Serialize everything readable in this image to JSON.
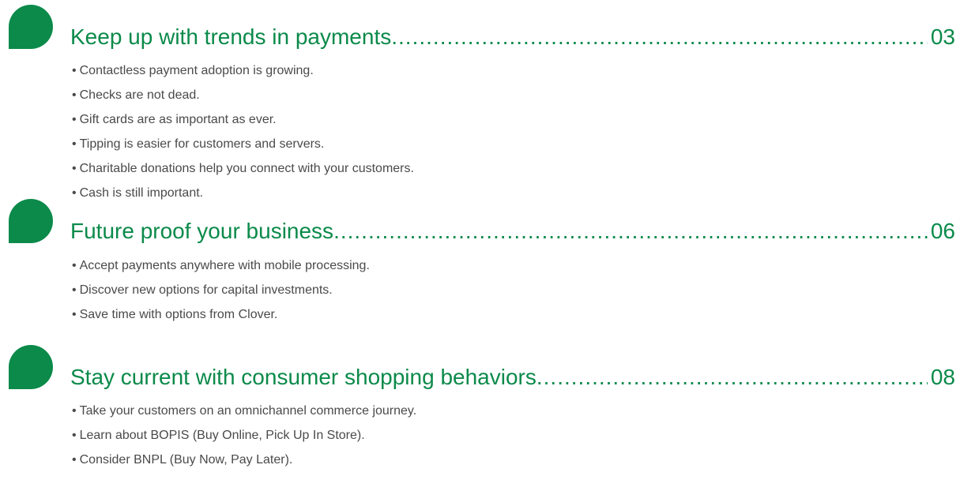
{
  "colors": {
    "accent": "#0b8a4a",
    "body_text": "#4a4a4a"
  },
  "sections": [
    {
      "title": "Keep up with trends in payments",
      "page": "03",
      "items": [
        "Contactless payment adoption is growing.",
        "Checks are not dead.",
        "Gift cards are as important as ever.",
        "Tipping is easier for customers and servers.",
        "Charitable donations help you connect with your customers.",
        "Cash is still important."
      ]
    },
    {
      "title": "Future proof your business",
      "page": "06",
      "items": [
        "Accept payments anywhere with mobile processing.",
        "Discover new options for capital investments.",
        "Save time with options from Clover."
      ]
    },
    {
      "title": "Stay current with consumer shopping behaviors",
      "page": "08",
      "items": [
        "Take your customers on an omnichannel commerce journey.",
        "Learn about BOPIS (Buy Online, Pick Up In Store).",
        "Consider BNPL (Buy Now, Pay Later)."
      ]
    }
  ],
  "bullet_glyph": "•"
}
